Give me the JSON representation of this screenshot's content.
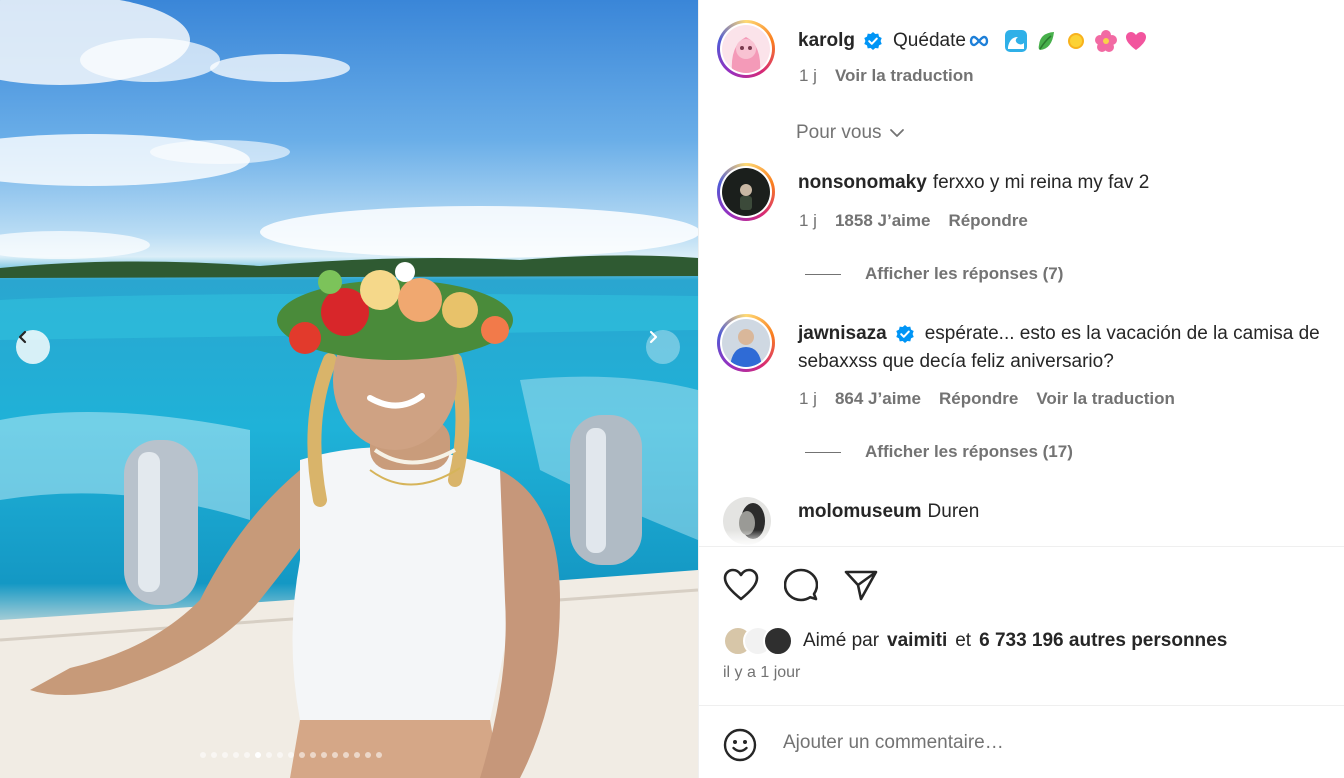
{
  "carousel": {
    "slide_count": 17,
    "active_index": 5
  },
  "caption": {
    "username": "karolg",
    "text": "Quédate",
    "emoji_icons": [
      "infinity-icon",
      "wave-icon",
      "leaf-icon",
      "sun-icon",
      "hibiscus-icon",
      "heart-icon"
    ],
    "time": "1 j",
    "translate": "Voir la traduction"
  },
  "sort": {
    "label": "Pour vous"
  },
  "comments": [
    {
      "username": "nonsonomaky",
      "text": "ferxxo y mi reina my fav 2",
      "time": "1 j",
      "likes": "1858 J’aime",
      "reply": "Répondre",
      "replies": "Afficher les réponses (7)"
    },
    {
      "username": "jawnisaza",
      "text_line1": "espérate... esto es la vacación de la camisa de",
      "text_line2": "sebaxxss que decía feliz aniversario?",
      "time": "1 j",
      "likes": "864 J’aime",
      "reply": "Répondre",
      "translate": "Voir la traduction",
      "replies": "Afficher les réponses (17)"
    },
    {
      "username": "molomuseum",
      "text": "Duren"
    }
  ],
  "likes": {
    "prefix": "Aimé par",
    "user": "vaimiti",
    "joiner": "et",
    "others": "6 733 196 autres personnes"
  },
  "posted": "il y a 1 jour",
  "comment_box": {
    "placeholder": "Ajouter un commentaire…"
  },
  "colors": {
    "verified": "#0095f6",
    "muted_text": "#737373",
    "primary_text": "#262626"
  }
}
